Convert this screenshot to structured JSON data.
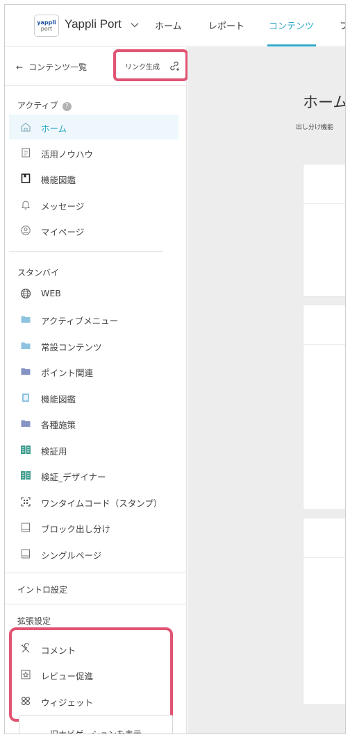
{
  "topbar": {
    "logo_line1": "yappli",
    "logo_line2": "port",
    "brand": "Yappli Port",
    "tabs": [
      {
        "label": "ホーム"
      },
      {
        "label": "レポート"
      },
      {
        "label": "コンテンツ"
      },
      {
        "label": "フ"
      }
    ],
    "active_tab": "コンテンツ",
    "accent_color": "#2fa8c8"
  },
  "sidebar": {
    "back_label": "コンテンツ一覧",
    "link_gen_label": "リンク生成",
    "active_heading": "アクティブ",
    "active_help": "?",
    "active_items": [
      {
        "label": "ホーム",
        "icon": "home-icon",
        "selected": true
      },
      {
        "label": "活用ノウハウ",
        "icon": "article-icon"
      },
      {
        "label": "機能図鑑",
        "icon": "book-icon"
      },
      {
        "label": "メッセージ",
        "icon": "bell-icon"
      },
      {
        "label": "マイページ",
        "icon": "user-circle-icon"
      }
    ],
    "standby_heading": "スタンバイ",
    "standby_items": [
      {
        "label": "WEB",
        "icon": "globe-icon"
      },
      {
        "label": "アクティブメニュー",
        "icon": "folder-icon"
      },
      {
        "label": "常設コンテンツ",
        "icon": "folder-icon"
      },
      {
        "label": "ポイント関連",
        "icon": "folder-icon"
      },
      {
        "label": "機能図鑑",
        "icon": "catalog-icon"
      },
      {
        "label": "各種施策",
        "icon": "folder-icon"
      },
      {
        "label": "検証用",
        "icon": "kensho-icon"
      },
      {
        "label": "検証_デザイナー",
        "icon": "kensho-icon"
      },
      {
        "label": "ワンタイムコード（スタンプ）",
        "icon": "qr-icon"
      },
      {
        "label": "ブロック出し分け",
        "icon": "page-icon"
      },
      {
        "label": "シングルページ",
        "icon": "page-icon"
      }
    ],
    "intro_heading": "イントロ設定",
    "extension_heading": "拡張設定",
    "extension_items": [
      {
        "label": "コメント",
        "icon": "tools-icon"
      },
      {
        "label": "レビュー促進",
        "icon": "star-box-icon"
      },
      {
        "label": "ウィジェット",
        "icon": "grid-icon"
      }
    ],
    "old_nav_label": "旧ナビゲーションを表示",
    "highlight_color": "#e05474"
  },
  "main": {
    "title": "ホーム",
    "subtitle": "出し分け機能"
  }
}
